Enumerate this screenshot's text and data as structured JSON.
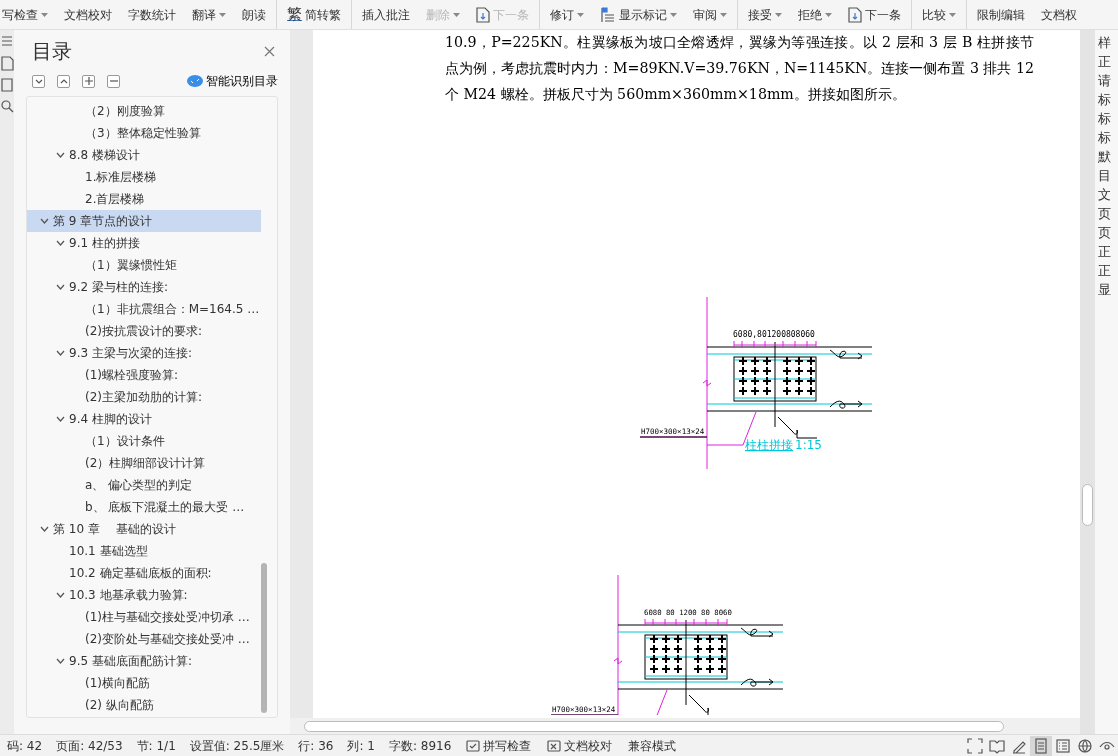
{
  "toolbar": [
    {
      "label": "写检查",
      "kind": "text",
      "dropdown": true,
      "disabled": false,
      "separator_before": false
    },
    {
      "label": "文档校对",
      "kind": "text",
      "dropdown": false,
      "disabled": false,
      "separator_before": false
    },
    {
      "label": "字数统计",
      "kind": "text",
      "dropdown": false,
      "disabled": false,
      "separator_before": false
    },
    {
      "label": "翻译",
      "kind": "text",
      "dropdown": true,
      "disabled": false,
      "separator_before": false
    },
    {
      "label": "朗读",
      "kind": "text",
      "dropdown": false,
      "disabled": false,
      "separator_before": false
    },
    {
      "label": "简转繁",
      "kind": "convert",
      "glyph": "繁",
      "dropdown": false,
      "disabled": false,
      "separator_before": true
    },
    {
      "label": "插入批注",
      "kind": "text",
      "dropdown": false,
      "disabled": false,
      "separator_before": true
    },
    {
      "label": "删除",
      "kind": "text",
      "dropdown": true,
      "disabled": true,
      "separator_before": false
    },
    {
      "label": "下一条",
      "kind": "next",
      "dropdown": false,
      "disabled": true,
      "separator_before": false
    },
    {
      "label": "修订",
      "kind": "text",
      "dropdown": true,
      "disabled": false,
      "separator_before": true
    },
    {
      "label": "显示标记",
      "kind": "markup",
      "dropdown": true,
      "disabled": false,
      "separator_before": false
    },
    {
      "label": "审阅",
      "kind": "text",
      "dropdown": true,
      "disabled": false,
      "separator_before": false
    },
    {
      "label": "接受",
      "kind": "text",
      "dropdown": true,
      "disabled": false,
      "separator_before": true
    },
    {
      "label": "拒绝",
      "kind": "text",
      "dropdown": true,
      "disabled": false,
      "separator_before": false
    },
    {
      "label": "下一条",
      "kind": "next",
      "dropdown": false,
      "disabled": false,
      "separator_before": false
    },
    {
      "label": "比较",
      "kind": "text",
      "dropdown": true,
      "disabled": false,
      "separator_before": true
    },
    {
      "label": "限制编辑",
      "kind": "text",
      "dropdown": false,
      "disabled": false,
      "separator_before": true
    },
    {
      "label": "文档权",
      "kind": "text",
      "dropdown": false,
      "disabled": false,
      "separator_before": false
    }
  ],
  "sidebar": {
    "title": "目录",
    "smart_button": "智能识别目录",
    "tree": [
      {
        "children": [
          {
            "children": [
              {
                "label": "（2）刚度验算",
                "selected": false
              },
              {
                "label": "（3）整体稳定性验算",
                "selected": false
              }
            ]
          },
          {
            "label": "8.8 楼梯设计",
            "selected": false,
            "expanded": true,
            "children": [
              {
                "label": "1.标准层楼梯",
                "selected": false
              },
              {
                "label": "2.首层楼梯",
                "selected": false
              }
            ]
          }
        ]
      },
      {
        "label": "第 9 章节点的设计",
        "selected": true,
        "expanded": true,
        "children": [
          {
            "label": "9.1 柱的拼接",
            "selected": false,
            "expanded": true,
            "children": [
              {
                "label": "（1）翼缘惯性矩",
                "selected": false
              }
            ]
          },
          {
            "label": "9.2 梁与柱的连接:",
            "selected": false,
            "expanded": true,
            "children": [
              {
                "label": "（1）非抗震组合：M=164.5 …",
                "selected": false
              },
              {
                "label": "(2)按抗震设计的要求:",
                "selected": false
              }
            ]
          },
          {
            "label": "9.3 主梁与次梁的连接:",
            "selected": false,
            "expanded": true,
            "children": [
              {
                "label": "(1)螺栓强度验算:",
                "selected": false
              },
              {
                "label": "(2)主梁加劲肋的计算:",
                "selected": false
              }
            ]
          },
          {
            "label": "9.4 柱脚的设计",
            "selected": false,
            "expanded": true,
            "children": [
              {
                "label": "（1）设计条件",
                "selected": false
              },
              {
                "label": "(2）柱脚细部设计计算",
                "selected": false
              },
              {
                "label": "a、 偏心类型的判定",
                "selected": false
              },
              {
                "label": "b、 底板下混凝土的最大受 …",
                "selected": false
              }
            ]
          }
        ]
      },
      {
        "label": "第 10 章　 基础的设计",
        "selected": false,
        "expanded": true,
        "children": [
          {
            "label": "10.1 基础选型",
            "selected": false
          },
          {
            "label": "10.2 确定基础底板的面积:",
            "selected": false
          },
          {
            "label": "10.3 地基承载力验算:",
            "selected": false,
            "expanded": true,
            "children": [
              {
                "label": "(1)柱与基础交接处受冲切承 …",
                "selected": false
              },
              {
                "label": "(2)变阶处与基础交接处受冲 …",
                "selected": false
              }
            ]
          },
          {
            "label": "9.5 基础底面配筋计算:",
            "selected": false,
            "expanded": true,
            "children": [
              {
                "label": "(1)横向配筋",
                "selected": false
              },
              {
                "label": "(2)  纵向配筋",
                "selected": false
              }
            ]
          }
        ]
      }
    ]
  },
  "document": {
    "paragraph": "10.9，P=225KN。柱翼缘板为坡口全熔透焊，翼缘为等强连接。以 2 层和 3 层 B 柱拼接节点为例，考虑抗震时内力：M=89KN.V=39.76KN，N=1145KN。连接一侧布置 3 排共 12 个 M24 螺栓。拼板尺寸为 560mm×360mm×18mm。拼接如图所示。",
    "figures": [
      {
        "dimensions": "6080,801200808060",
        "section": "H700×300×13×24",
        "caption": "柱柱拼接",
        "scale": "1:15"
      },
      {
        "dimensions": "6080 80 1200 80 8060",
        "section": "H700×300×13×24"
      }
    ]
  },
  "right_pane": {
    "texts": [
      "样",
      "正",
      "请",
      "标",
      "标",
      "标",
      "默",
      "目",
      "文",
      "页",
      "页",
      "正",
      "正",
      "显"
    ]
  },
  "status_bar": {
    "items": [
      "码: 42",
      "页面: 42/53",
      "节: 1/1",
      "设置值: 25.5厘米",
      "行: 36",
      "列: 1",
      "字数: 8916"
    ],
    "buttons": [
      {
        "label": "拼写检查",
        "kind": "spell"
      },
      {
        "label": "文档校对",
        "kind": "proof"
      },
      {
        "label": "兼容模式",
        "kind": "text"
      }
    ],
    "views": [
      {
        "kind": "fullscreen",
        "selected": false
      },
      {
        "kind": "read",
        "selected": false
      },
      {
        "kind": "pen",
        "selected": false
      },
      {
        "kind": "page",
        "selected": true
      },
      {
        "kind": "outline",
        "selected": false
      },
      {
        "kind": "web",
        "selected": false
      },
      {
        "kind": "eye",
        "selected": false
      }
    ]
  }
}
